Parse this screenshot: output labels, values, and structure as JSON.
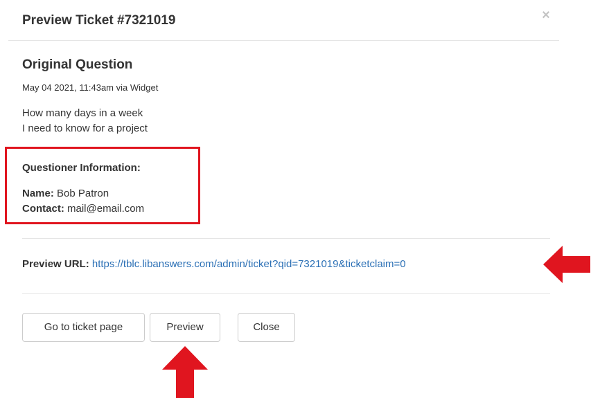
{
  "modal": {
    "title": "Preview Ticket #7321019",
    "close_glyph": "×"
  },
  "question": {
    "heading": "Original Question",
    "meta": "May 04 2021, 11:43am via Widget",
    "lines": [
      "How many days in a week",
      "I need to know for a project"
    ]
  },
  "questioner": {
    "heading": "Questioner Information:",
    "name_label": "Name:",
    "name_value": "Bob Patron",
    "contact_label": "Contact:",
    "contact_value": "mail@email.com"
  },
  "preview_url": {
    "label": "Preview URL:",
    "url": "https://tblc.libanswers.com/admin/ticket?qid=7321019&ticketclaim=0"
  },
  "buttons": {
    "go_to_ticket": "Go to ticket page",
    "preview": "Preview",
    "close": "Close"
  },
  "annotations": {
    "highlight_color": "#e0151f",
    "arrows": [
      "arrow-left-icon",
      "arrow-up-icon"
    ]
  },
  "colors": {
    "link": "#2a6fb5",
    "border": "#cccccc",
    "text": "#333333"
  }
}
